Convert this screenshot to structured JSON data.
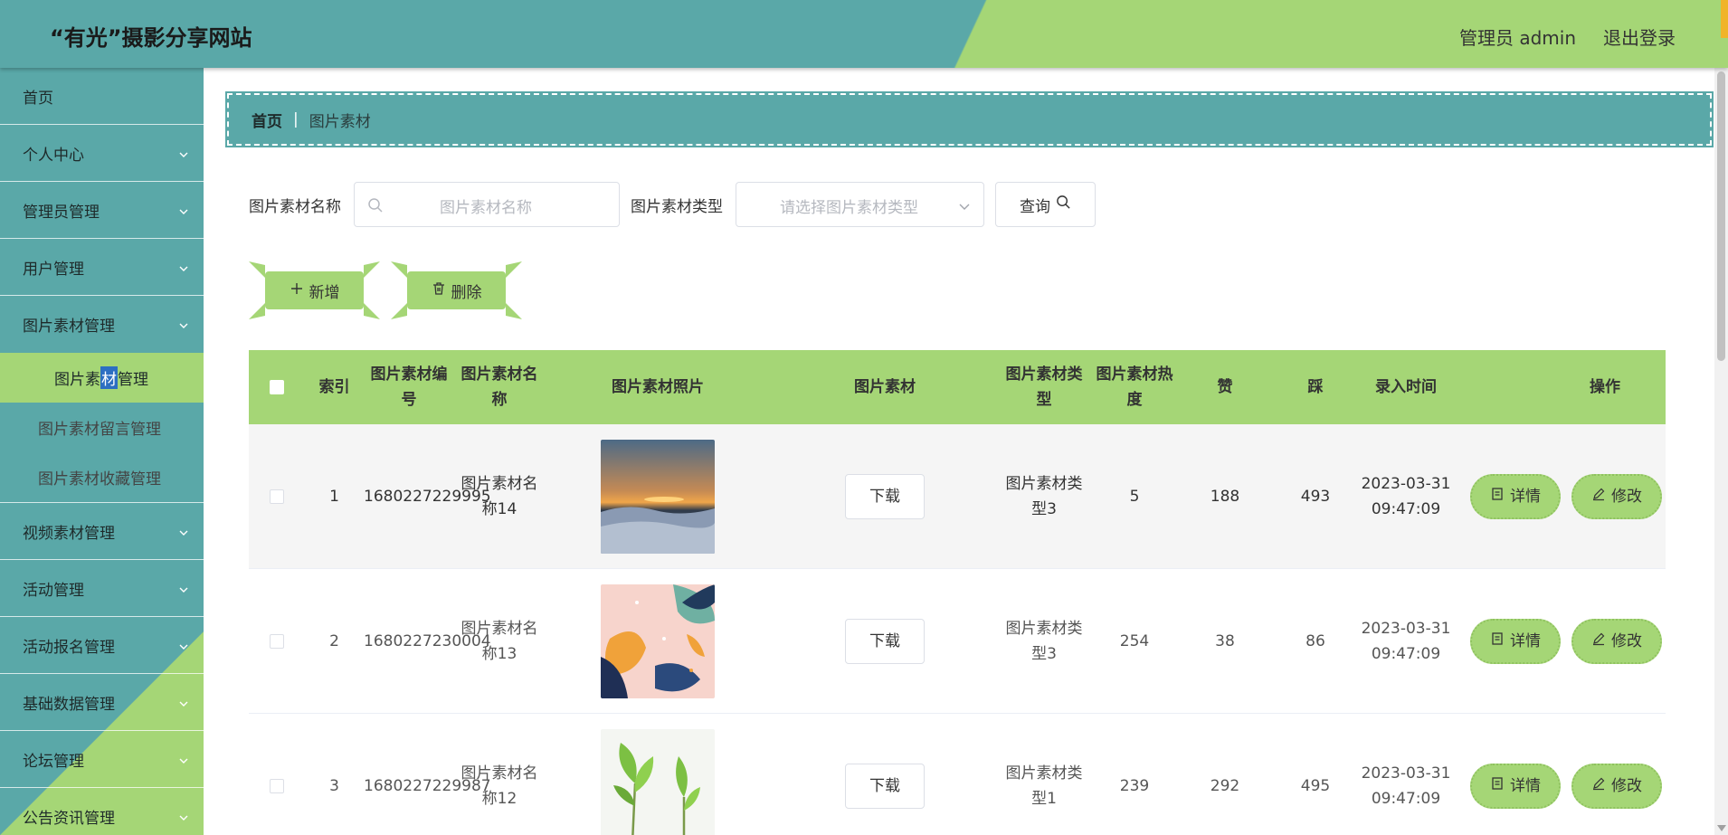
{
  "header": {
    "title": "“有光”摄影分享网站",
    "admin": "管理员 admin",
    "logout": "退出登录"
  },
  "colors": {
    "teal": "#5aa8a8",
    "green": "#a5d676"
  },
  "sidebar": {
    "items": [
      {
        "label": "首页",
        "icon": "none"
      },
      {
        "label": "个人中心",
        "icon": "chevron-down-icon"
      },
      {
        "label": "管理员管理",
        "icon": "chevron-down-icon"
      },
      {
        "label": "用户管理",
        "icon": "chevron-down-icon"
      },
      {
        "label": "图片素材管理",
        "icon": "chevron-down-icon"
      },
      {
        "label": "视频素材管理",
        "icon": "chevron-down-icon"
      },
      {
        "label": "活动管理",
        "icon": "chevron-down-icon"
      },
      {
        "label": "活动报名管理",
        "icon": "chevron-down-icon"
      },
      {
        "label": "基础数据管理",
        "icon": "chevron-down-icon"
      },
      {
        "label": "论坛管理",
        "icon": "chevron-down-icon"
      },
      {
        "label": "公告资讯管理",
        "icon": "chevron-down-icon"
      }
    ],
    "submenu": {
      "active_pre": "图片素",
      "active_mark": "材",
      "active_post": "管理",
      "items": [
        "图片素材留言管理",
        "图片素材收藏管理"
      ]
    }
  },
  "breadcrumb": {
    "home": "首页",
    "sep": "|",
    "current": "图片素材"
  },
  "search": {
    "name_label": "图片素材名称",
    "name_placeholder": "图片素材名称",
    "type_label": "图片素材类型",
    "type_placeholder": "请选择图片素材类型",
    "query_label": "查询"
  },
  "actions": {
    "add_label": "新增",
    "delete_label": "删除"
  },
  "table": {
    "headers": {
      "index": "索引",
      "code": "图片素材编号",
      "name": "图片素材名称",
      "photo": "图片素材照片",
      "file": "图片素材",
      "type": "图片素材类型",
      "hot": "图片素材热度",
      "like": "赞",
      "dislike": "踩",
      "time": "录入时间",
      "ops": "操作"
    },
    "rows": [
      {
        "index": "1",
        "code": "1680227229995",
        "name": "图片素材名称14",
        "photo": "sunset-over-snowy-hills",
        "download": "下载",
        "type": "图片素材类型3",
        "hot": "5",
        "like": "188",
        "dislike": "493",
        "time": "2023-03-31 09:47:09",
        "detail": "详情",
        "edit": "修改"
      },
      {
        "index": "2",
        "code": "1680227230004",
        "name": "图片素材名称13",
        "photo": "floral-leaf-illustration",
        "download": "下载",
        "type": "图片素材类型3",
        "hot": "254",
        "like": "38",
        "dislike": "86",
        "time": "2023-03-31 09:47:09",
        "detail": "详情",
        "edit": "修改"
      },
      {
        "index": "3",
        "code": "1680227229987",
        "name": "图片素材名称12",
        "photo": "green-tea-sprouts",
        "download": "下载",
        "type": "图片素材类型1",
        "hot": "239",
        "like": "292",
        "dislike": "495",
        "time": "2023-03-31 09:47:09",
        "detail": "详情",
        "edit": "修改"
      }
    ]
  }
}
